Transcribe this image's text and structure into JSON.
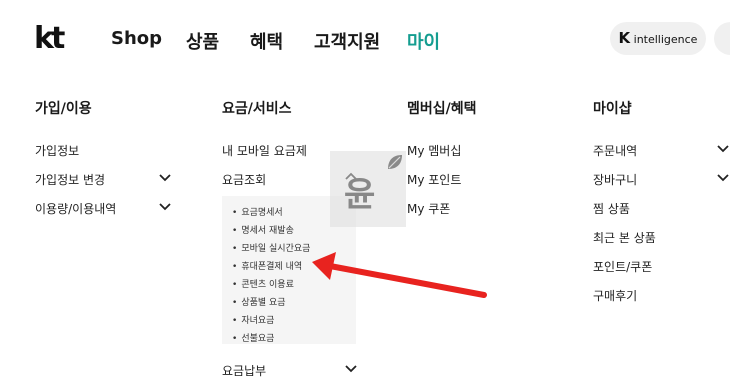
{
  "header": {
    "logo": "kt",
    "nav": [
      "Shop",
      "상품",
      "혜택",
      "고객지원",
      "마이"
    ],
    "active_nav_index": 4,
    "ai_button_letter": "K",
    "ai_button_label": "intelligence"
  },
  "columns": [
    {
      "title": "가입/이용",
      "items": [
        {
          "label": "가입정보",
          "expandable": false
        },
        {
          "label": "가입정보 변경",
          "expandable": true
        },
        {
          "label": "이용량/이용내역",
          "expandable": true
        }
      ]
    },
    {
      "title": "요금/서비스",
      "items": [
        {
          "label": "내 모바일 요금제",
          "expandable": false
        },
        {
          "label": "요금조회",
          "expandable": true,
          "expanded": true
        },
        {
          "label": "요금납부",
          "expandable": true
        }
      ],
      "submenu": [
        "요금명세서",
        "명세서 재발송",
        "모바일 실시간요금",
        "휴대폰결제 내역",
        "콘텐츠 이용료",
        "상품별 요금",
        "자녀요금",
        "선불요금"
      ]
    },
    {
      "title": "멤버십/혜택",
      "items": [
        {
          "label": "My 멤버십",
          "expandable": false
        },
        {
          "label": "My 포인트",
          "expandable": false
        },
        {
          "label": "My 쿠폰",
          "expandable": false
        }
      ]
    },
    {
      "title": "마이샵",
      "items": [
        {
          "label": "주문내역",
          "expandable": true
        },
        {
          "label": "장바구니",
          "expandable": true
        },
        {
          "label": "찜 상품",
          "expandable": false
        },
        {
          "label": "최근 본 상품",
          "expandable": false
        },
        {
          "label": "포인트/쿠폰",
          "expandable": false
        },
        {
          "label": "구매후기",
          "expandable": false
        }
      ]
    }
  ],
  "watermark_char": "윤",
  "colors": {
    "active": "#149d90",
    "arrow": "#e8231f",
    "submenu_bg": "#f5f5f5"
  }
}
